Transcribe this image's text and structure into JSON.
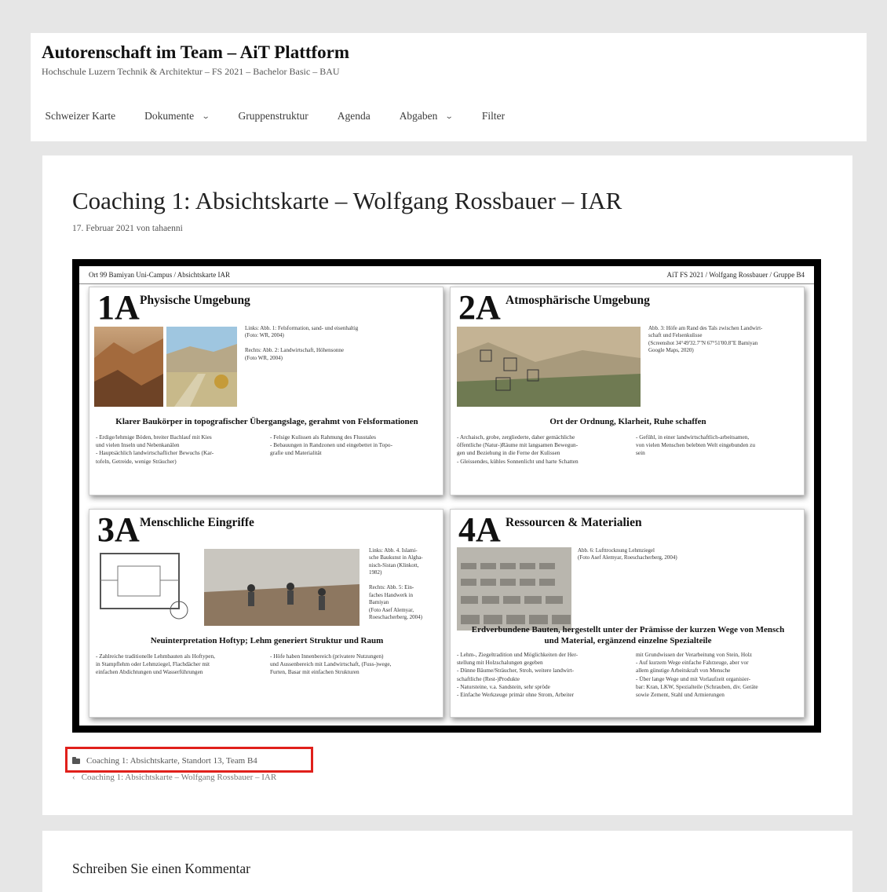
{
  "site": {
    "title": "Autorenschaft im Team – AiT Plattform",
    "description": "Hochschule Luzern Technik & Architektur – FS 2021 – Bachelor Basic – BAU"
  },
  "nav": [
    {
      "label": "Schweizer Karte",
      "dropdown": false
    },
    {
      "label": "Dokumente",
      "dropdown": true
    },
    {
      "label": "Gruppenstruktur",
      "dropdown": false
    },
    {
      "label": "Agenda",
      "dropdown": false
    },
    {
      "label": "Abgaben",
      "dropdown": true
    },
    {
      "label": "Filter",
      "dropdown": false
    }
  ],
  "post": {
    "title": "Coaching 1: Absichtskarte – Wolfgang Rossbauer – IAR",
    "date": "17. Februar 2021",
    "by": "von",
    "author": "tahaenni",
    "category": "Coaching 1: Absichtskarte, Standort 13, Team B4",
    "nav_link": "Coaching 1: Absichtskarte – Wolfgang Rossbauer – IAR",
    "nav_arrow": "‹"
  },
  "poster": {
    "header_left": "Ort 99 Bamiyan Uni-Campus / Absichtskarte IAR",
    "header_right": "AiT FS 2021 / Wolfgang Rossbauer / Gruppe B4",
    "cards": [
      {
        "num": "1A",
        "title": "Physische Umgebung",
        "caption": "Links: Abb. 1: Felsformation, sand- und eisenhaltig\n(Foto: WR, 2004)\n\nRechts: Abb. 2: Landwirtschaft, Höhensonne\n(Foto WR, 2004)",
        "subtitle": "Klarer Baukörper in topografischer Übergangslage, gerahmt von Felsformationen",
        "bullets_left": "- Erdige/lehmige Böden, breiter Bachlauf mit Kies\n  und vielen Inseln und Nebenkanälen\n- Hauptsächlich landwirtschaflicher Bewuchs (Kar-\n  tofeln, Getreide, wenige Sträucher)",
        "bullets_right": "- Felsige Kulissen als Rahmung des Flusstales\n- Bebauungen in Randzonen und eingebettet in Topo-\n  grafie und Materialität"
      },
      {
        "num": "2A",
        "title": "Atmosphärische Umgebung",
        "caption": "Abb. 3: Höfe am Rand des Tals zwischen Landwirt-\nschaft und Felsenkulisse\n(Screenshot 34°49'32.7\"N 67°51'00.8\"E Bamiyan\nGoogle Maps, 2020)",
        "subtitle": "Ort der Ordnung, Klarheit, Ruhe schaffen",
        "bullets_left": "- Archaisch, grobe, zergliederte, daher gemächliche\n  öffentliche (Natur-)Räume mit langsamen Bewegun-\n  gen und Beziehung in die Ferne der Kulissen\n- Gleissendes, kühles Sonnenlicht und harte Schatten",
        "bullets_right": "- Gefühl, in einer landwirtschaftlich-arbeitsamen,\n  von vielen Menschen belebten Welt eingebunden zu\n  sein"
      },
      {
        "num": "3A",
        "title": "Menschliche Eingriffe",
        "caption": "Links: Abb. 4. Islami-\nsche Baukunst in Algha-\nnisch-Sistan (Klinkott,\n1982)\n\nRechts: Abb. 5: Ein-\nfaches Handwerk in\nBamiyan\n(Foto Asef Alemyar,\nRoeschacherberg, 2004)",
        "subtitle": "Neuinterpretation Hoftyp; Lehm generiert Struktur und Raum",
        "bullets_left": "- Zahlreiche traditionelle Lehmbauten als Hoftypen,\n  in Stampflehm oder Lehmziegel, Flachdächer mit\n  einfachen Abdichtungen und Wasserführungen",
        "bullets_right": "- Höfe haben Innenbereich (privatere Nutzungen)\n  und Aussenbereich mit Landwirtschaft, (Fuss-)wege,\n  Furten, Basar mit einfachen Strukturen"
      },
      {
        "num": "4A",
        "title": "Ressourcen & Materialien",
        "caption": "Abb. 6: Lufttrocknung Lehmziegel\n(Foto Asef Alemyar, Roeschacherberg, 2004)",
        "subtitle": "Erdverbundene Bauten, hergestellt unter der Prämisse der kurzen Wege von Mensch\nund Material, ergänzend einzelne Spezialteile",
        "bullets_left": "- Lehm-, Ziegeltradition und Möglichkeiten der Her-\n  stellung mit Holzschalungen gegeben\n- Dünne Bäume/Sträucher, Stroh, weitere landwirt-\n  schaftliche (Rest-)Produkte\n- Natursteine, v.a. Sandstein, sehr spröde\n- Einfache Werkzeuge primär ohne Strom, Arbeiter",
        "bullets_right": "mit Grundwissen der Verarbeitung von Stein, Holz\n- Auf kurzem Wege einfache Fahrzeuge, aber vor\n  allem günstige Arbeitskraft von Mensche\n- Über lange Wege und mit Vorlaufzeit organisier-\n  bar: Kran, LKW, Spezialteile (Schrauben, div. Geräte\n  sowie Zement, Stahl und Armierungen"
      }
    ]
  },
  "comments": {
    "title": "Schreiben Sie einen Kommentar"
  },
  "colors": {
    "highlight": "#e0201b",
    "background": "#e6e6e6"
  }
}
